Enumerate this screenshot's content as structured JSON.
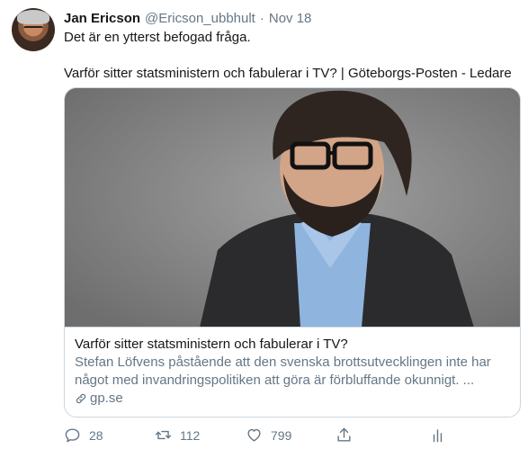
{
  "tweet": {
    "author_name": "Jan Ericson",
    "author_handle": "@Ericson_ubbhult",
    "separator": "·",
    "date": "Nov 18",
    "text_line1": "Det är en ytterst befogad fråga.",
    "text_line2": "Varför sitter statsministern och fabulerar i TV? | Göteborgs-Posten - Ledare"
  },
  "card": {
    "title": "Varför sitter statsministern och fabulerar i TV?",
    "description": "Stefan Löfvens påstående att den svenska brottsutvecklingen inte har något med invandringspolitiken att göra är förbluffande okunnigt. ...",
    "domain": "gp.se",
    "domain_icon": "link-icon"
  },
  "actions": {
    "reply_count": "28",
    "retweet_count": "112",
    "like_count": "799"
  },
  "colors": {
    "text_primary": "#14171a",
    "text_secondary": "#657786",
    "border": "#ccd6dd"
  }
}
